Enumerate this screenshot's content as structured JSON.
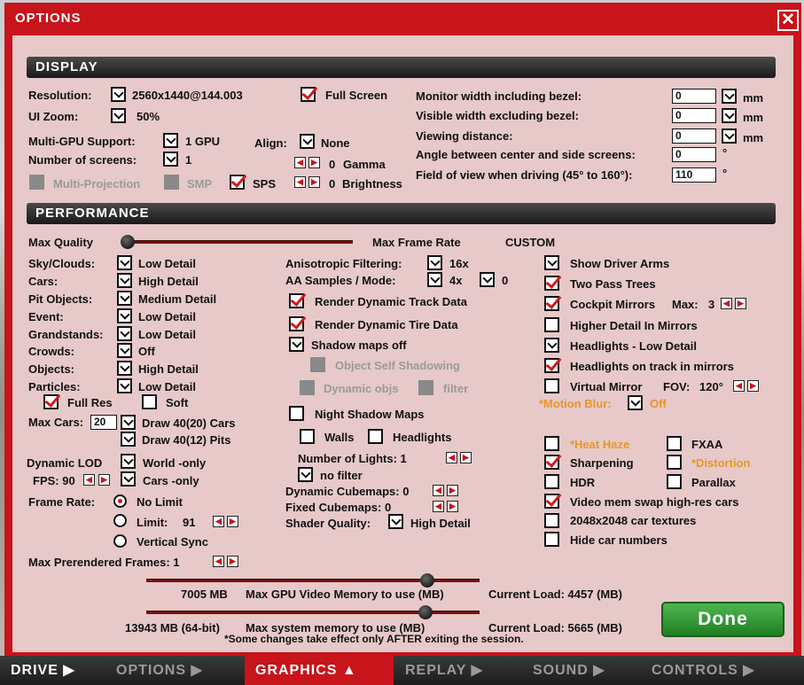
{
  "window": {
    "title": "OPTIONS",
    "close_icon": "close-icon"
  },
  "display": {
    "header": "DISPLAY",
    "resolution_label": "Resolution:",
    "resolution_value": "2560x1440@144.003",
    "ui_zoom_label": "UI Zoom:",
    "ui_zoom_value": "50%",
    "multigpu_label": "Multi-GPU Support:",
    "multigpu_value": "1 GPU",
    "screens_label": "Number of screens:",
    "screens_value": "1",
    "multiprojection_label": "Multi-Projection",
    "smp_label": "SMP",
    "sps_label": "SPS",
    "fullscreen_label": "Full Screen",
    "align_label": "Align:",
    "align_value": "None",
    "gamma_value": "0",
    "gamma_label": "Gamma",
    "brightness_value": "0",
    "brightness_label": "Brightness",
    "monitor_width_label": "Monitor width including bezel:",
    "monitor_width_value": "0",
    "visible_width_label": "Visible width excluding bezel:",
    "visible_width_value": "0",
    "viewing_distance_label": "Viewing distance:",
    "viewing_distance_value": "0",
    "angle_label": "Angle between center and side screens:",
    "angle_value": "0",
    "fov_label": "Field of view when driving (45° to 160°):",
    "fov_value": "110",
    "unit_mm": "mm",
    "unit_deg": "°"
  },
  "performance": {
    "header": "PERFORMANCE",
    "max_quality_label": "Max Quality",
    "max_frame_rate_label": "Max Frame Rate",
    "custom_label": "CUSTOM",
    "sky_label": "Sky/Clouds:",
    "sky_value": "Low Detail",
    "cars_label": "Cars:",
    "cars_value": "High Detail",
    "pit_label": "Pit Objects:",
    "pit_value": "Medium Detail",
    "event_label": "Event:",
    "event_value": "Low Detail",
    "grandstands_label": "Grandstands:",
    "grandstands_value": "Low Detail",
    "crowds_label": "Crowds:",
    "crowds_value": "Off",
    "objects_label": "Objects:",
    "objects_value": "High Detail",
    "particles_label": "Particles:",
    "particles_value": "Low Detail",
    "full_res_label": "Full Res",
    "soft_label": "Soft",
    "max_cars_label": "Max Cars:",
    "max_cars_value": "20",
    "draw_cars_label": "Draw 40(20) Cars",
    "draw_pits_label": "Draw 40(12) Pits",
    "dynamic_lod_label": "Dynamic LOD",
    "world_only_label": "World -only",
    "fps_label": "FPS: 90",
    "cars_only_label": "Cars -only",
    "frame_rate_label": "Frame Rate:",
    "no_limit_label": "No Limit",
    "limit_label": "Limit:",
    "limit_value": "91",
    "vsync_label": "Vertical Sync",
    "prerendered_label": "Max Prerendered Frames: 1",
    "aniso_label": "Anisotropic Filtering:",
    "aniso_value": "16x",
    "aa_label": "AA Samples / Mode:",
    "aa_value": "4x",
    "aa_mode_value": "0",
    "render_track_label": "Render Dynamic Track Data",
    "render_tire_label": "Render Dynamic Tire Data",
    "shadow_maps_label": "Shadow maps off",
    "object_self_shadow_label": "Object Self Shadowing",
    "dynamic_objs_label": "Dynamic objs",
    "filter_label": "filter",
    "night_shadow_label": "Night Shadow Maps",
    "walls_label": "Walls",
    "headlights_label": "Headlights",
    "lights_label": "Number of Lights: 1",
    "no_filter_label": "no filter",
    "dyn_cubemaps_label": "Dynamic Cubemaps: 0",
    "fixed_cubemaps_label": "Fixed Cubemaps: 0",
    "shader_label": "Shader Quality:",
    "shader_value": "High Detail",
    "show_arms_label": "Show Driver Arms",
    "two_pass_label": "Two Pass Trees",
    "cockpit_mirrors_label": "Cockpit Mirrors",
    "cockpit_max_label": "Max:",
    "cockpit_max_value": "3",
    "higher_mirror_label": "Higher Detail In Mirrors",
    "headlights_low_label": "Headlights - Low Detail",
    "headlights_track_label": "Headlights on track in mirrors",
    "virtual_mirror_label": "Virtual Mirror",
    "fov_label": "FOV:",
    "fov_value": "120°",
    "motion_blur_label": "*Motion Blur:",
    "motion_blur_value": "Off",
    "heat_haze_label": "*Heat Haze",
    "fxaa_label": "FXAA",
    "sharpening_label": "Sharpening",
    "distortion_label": "*Distortion",
    "hdr_label": "HDR",
    "parallax_label": "Parallax",
    "vmem_swap_label": "Video mem swap high-res cars",
    "textures_label": "2048x2048 car textures",
    "hide_numbers_label": "Hide car numbers",
    "gpu_mem_value": "7005 MB",
    "gpu_mem_label": "Max GPU Video Memory to use (MB)",
    "gpu_load": "Current Load: 4457 (MB)",
    "sys_mem_value": "13943 MB (64-bit)",
    "sys_mem_label": "Max system memory to use (MB)",
    "sys_load": "Current Load: 5665 (MB)",
    "note": "*Some changes take effect only AFTER exiting the session."
  },
  "done_label": "Done",
  "tabs": [
    {
      "label": "DRIVE ▶"
    },
    {
      "label": "OPTIONS ▶"
    },
    {
      "label": "GRAPHICS ▲"
    },
    {
      "label": "REPLAY ▶"
    },
    {
      "label": "SOUND ▶"
    },
    {
      "label": "CONTROLS ▶"
    }
  ],
  "colors": {
    "brand_red": "#c8141b",
    "accent_orange": "#e8962a",
    "done_green": "#2f9a33"
  }
}
